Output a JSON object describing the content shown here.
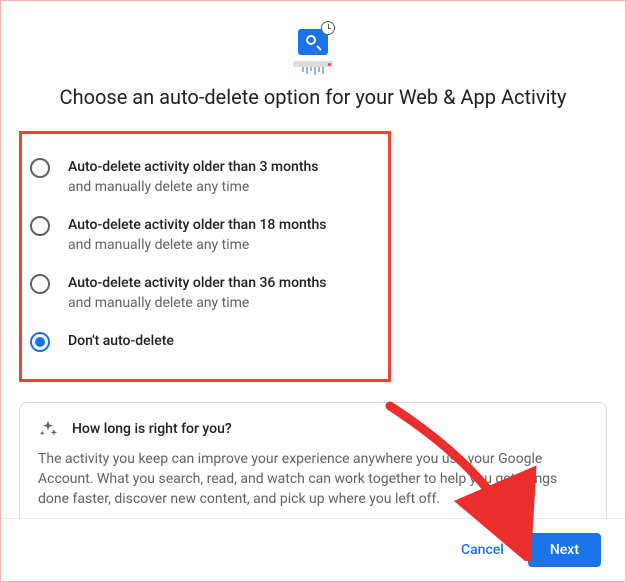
{
  "title": "Choose an auto-delete option for your Web & App Activity",
  "options": [
    {
      "label": "Auto-delete activity older than 3 months",
      "sub": "and manually delete any time",
      "selected": false
    },
    {
      "label": "Auto-delete activity older than 18 months",
      "sub": "and manually delete any time",
      "selected": false
    },
    {
      "label": "Auto-delete activity older than 36 months",
      "sub": "and manually delete any time",
      "selected": false
    },
    {
      "label": "Don't auto-delete",
      "sub": "",
      "selected": true
    }
  ],
  "info": {
    "title": "How long is right for you?",
    "body": "The activity you keep can improve your experience anywhere you use your Google Account. What you search, read, and watch can work together to help you get things done faster, discover new content, and pick up where you left off."
  },
  "footer": {
    "cancel": "Cancel",
    "next": "Next"
  }
}
